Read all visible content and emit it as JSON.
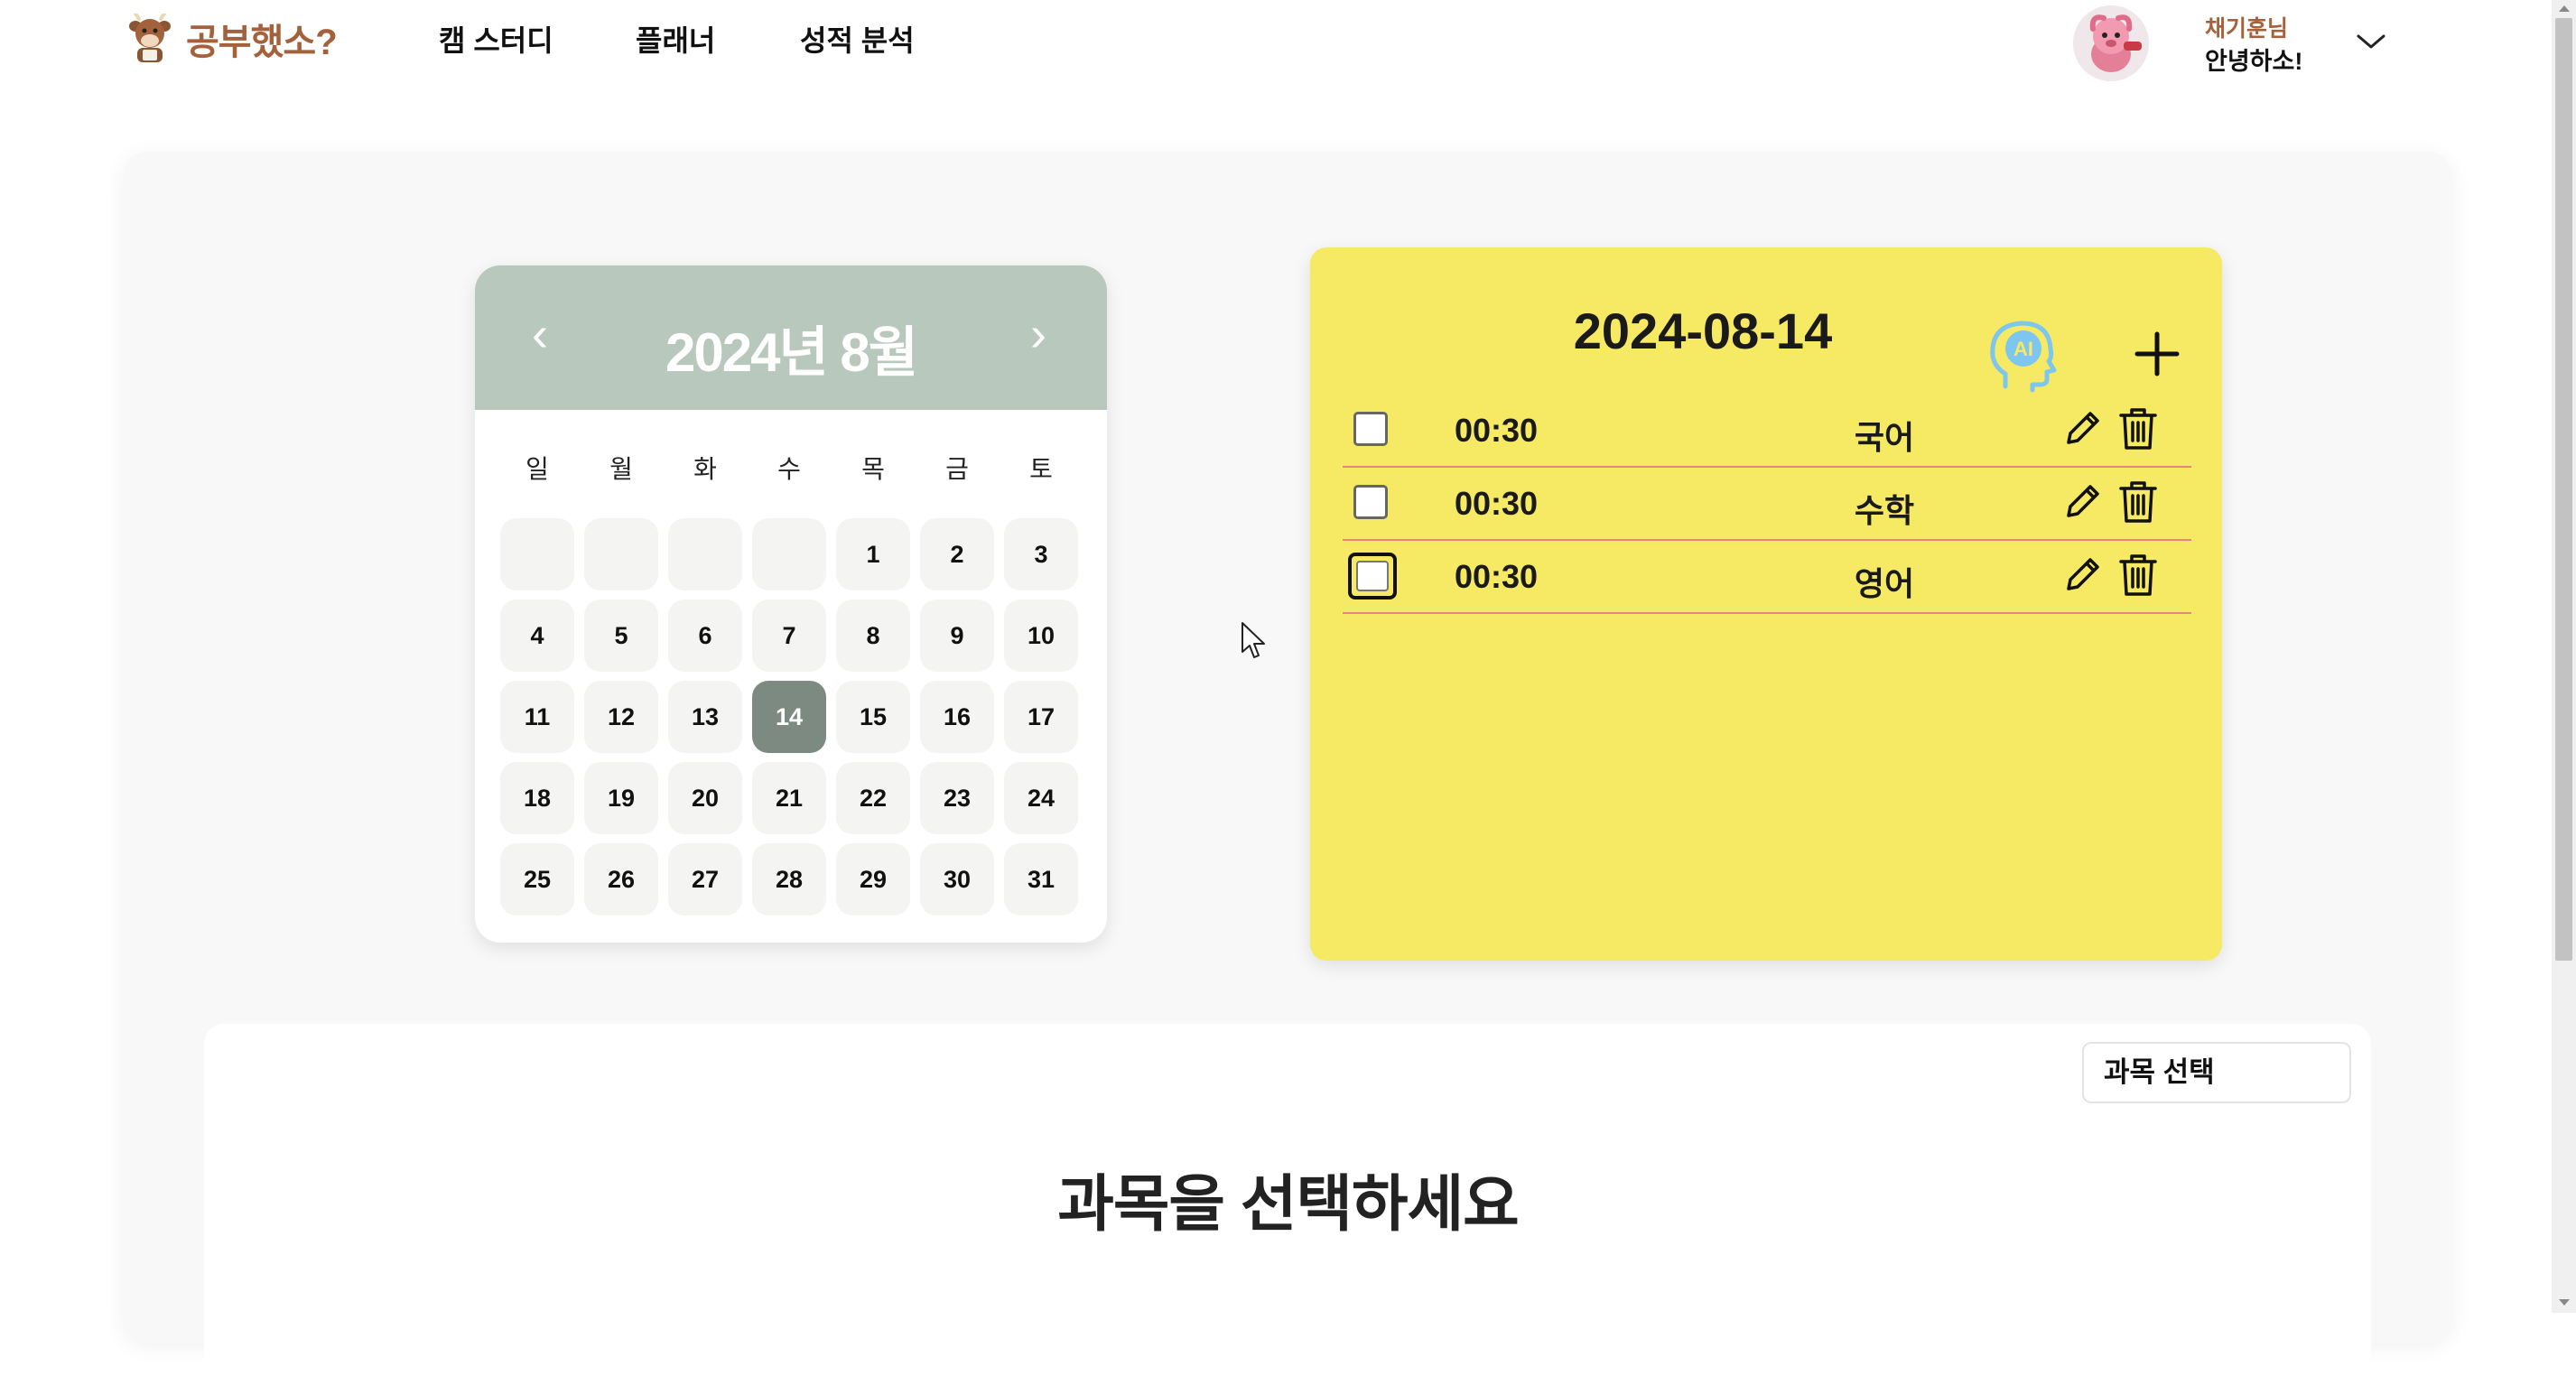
{
  "header": {
    "logo_text": "공부했소?",
    "nav": [
      "캠 스터디",
      "플래너",
      "성적 분석"
    ],
    "user": {
      "name": "채기훈님",
      "greeting": "안녕하소!"
    }
  },
  "calendar": {
    "title": "2024년 8월",
    "prev_label": "‹",
    "next_label": "›",
    "weekdays": [
      "일",
      "월",
      "화",
      "수",
      "목",
      "금",
      "토"
    ],
    "leading_blank_days": 4,
    "days_in_month": 31,
    "selected_day": 14,
    "colors": {
      "header": "#b8c8bc",
      "selected": "#7d8a81",
      "cell": "#f4f5f3"
    }
  },
  "planner": {
    "date": "2024-08-14",
    "ai_label": "AI",
    "tasks": [
      {
        "time": "00:30",
        "subject": "국어"
      },
      {
        "time": "00:30",
        "subject": "수학"
      },
      {
        "time": "00:30",
        "subject": "영어"
      }
    ],
    "colors": {
      "background": "#f6e964",
      "row_divider": "#e8847c",
      "ai_icon": "#7dc6ee"
    }
  },
  "analysis": {
    "select_label": "과목 선택",
    "placeholder": "과목을 선택하세요"
  },
  "icons": {
    "logo": "cow-mascot-icon",
    "dropdown": "chevron-down-icon",
    "ai": "ai-head-icon",
    "add": "plus-icon",
    "edit": "pencil-icon",
    "delete": "trash-icon"
  },
  "colors": {
    "brand": "#a4623c",
    "panel": "#f8f8f8"
  }
}
